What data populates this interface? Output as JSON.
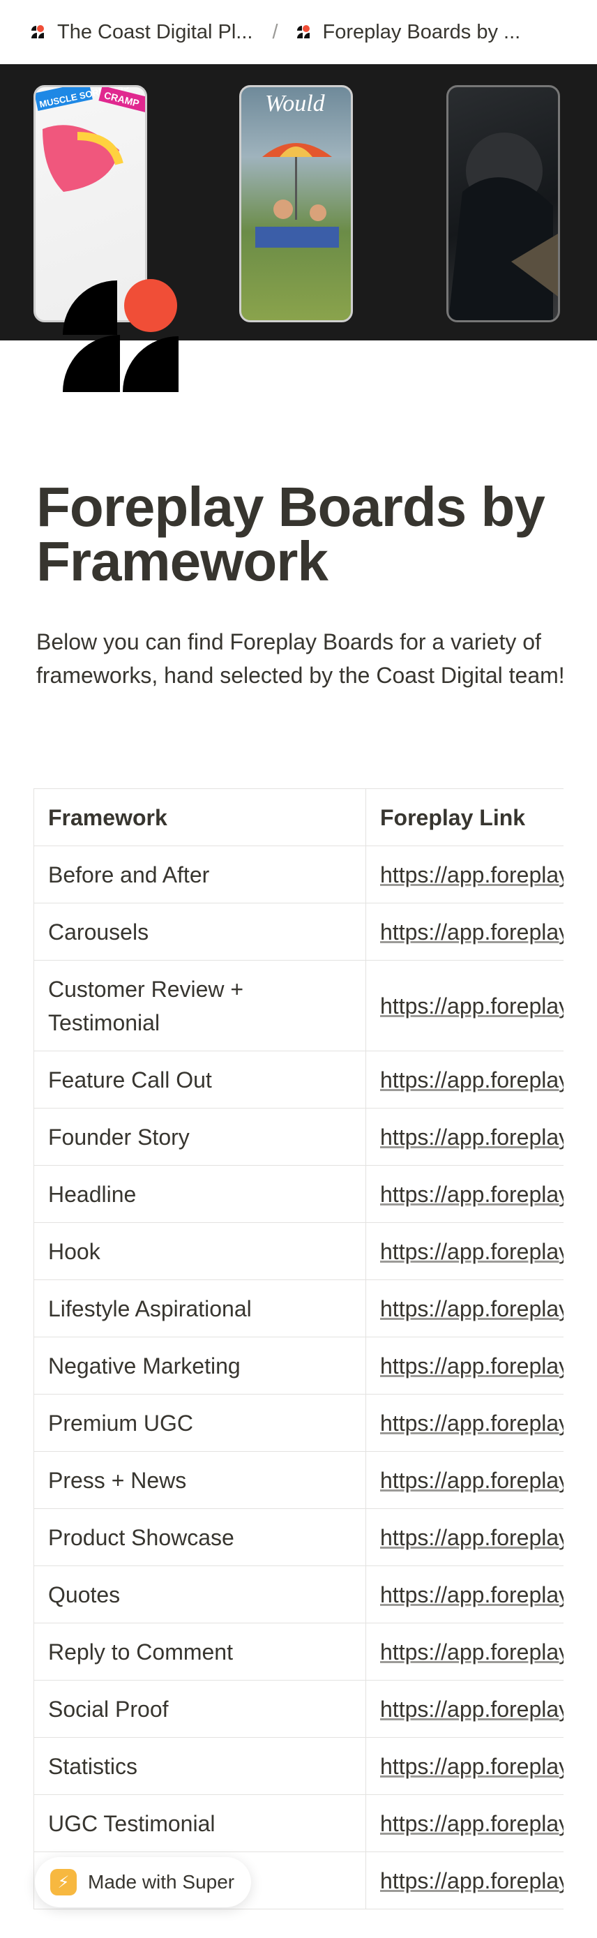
{
  "breadcrumb": {
    "items": [
      {
        "label": "The Coast Digital Pl..."
      },
      {
        "label": "Foreplay Boards by ..."
      }
    ],
    "separator": "/"
  },
  "cover": {
    "ad_thumbnails": [
      {
        "texts": [
          "MUSCLE SORENESS",
          "CRAMP"
        ]
      },
      {
        "texts": [
          "Would"
        ]
      },
      {
        "texts": []
      }
    ]
  },
  "page": {
    "title": "Foreplay Boards by Framework",
    "intro": "Below you can find Foreplay Boards for a variety of frameworks, hand selected by the Coast Digital team!"
  },
  "table": {
    "headers": [
      "Framework",
      "Foreplay Link"
    ],
    "rows": [
      {
        "framework": "Before and After",
        "link": "https://app.foreplay.co/share/boards/..."
      },
      {
        "framework": "Carousels",
        "link": "https://app.foreplay.co/share/boards/..."
      },
      {
        "framework": "Customer Review + Testimonial",
        "link": "https://app.foreplay.co/share/boards/..."
      },
      {
        "framework": "Feature Call Out",
        "link": "https://app.foreplay.co/share/boards/..."
      },
      {
        "framework": "Founder Story",
        "link": "https://app.foreplay.co/share/boards/..."
      },
      {
        "framework": "Headline",
        "link": "https://app.foreplay.co/share/boards/..."
      },
      {
        "framework": "Hook",
        "link": "https://app.foreplay.co/share/boards/..."
      },
      {
        "framework": "Lifestyle Aspirational",
        "link": "https://app.foreplay.co/share/boards/..."
      },
      {
        "framework": "Negative Marketing",
        "link": "https://app.foreplay.co/share/boards/..."
      },
      {
        "framework": "Premium UGC",
        "link": "https://app.foreplay.co/share/boards/..."
      },
      {
        "framework": "Press + News",
        "link": "https://app.foreplay.co/share/boards/..."
      },
      {
        "framework": "Product Showcase",
        "link": "https://app.foreplay.co/share/boards/..."
      },
      {
        "framework": "Quotes",
        "link": "https://app.foreplay.co/share/boards/..."
      },
      {
        "framework": "Reply to Comment",
        "link": "https://app.foreplay.co/share/boards/..."
      },
      {
        "framework": "Social Proof",
        "link": "https://app.foreplay.co/share/boards/..."
      },
      {
        "framework": "Statistics",
        "link": "https://app.foreplay.co/share/boards/..."
      },
      {
        "framework": "UGC Testimonial",
        "link": "https://app.foreplay.co/share/boards/..."
      },
      {
        "framework": "",
        "link": "https://app.foreplay.co/share/boards/..."
      }
    ]
  },
  "badge": {
    "label": "Made with Super",
    "icon": "lightning-icon"
  },
  "colors": {
    "text": "#37352f",
    "cover_bg": "#1b1b1b",
    "logo_accent": "#f04e37",
    "badge_icon_bg": "#f7b840",
    "border": "#e3e2e0"
  }
}
